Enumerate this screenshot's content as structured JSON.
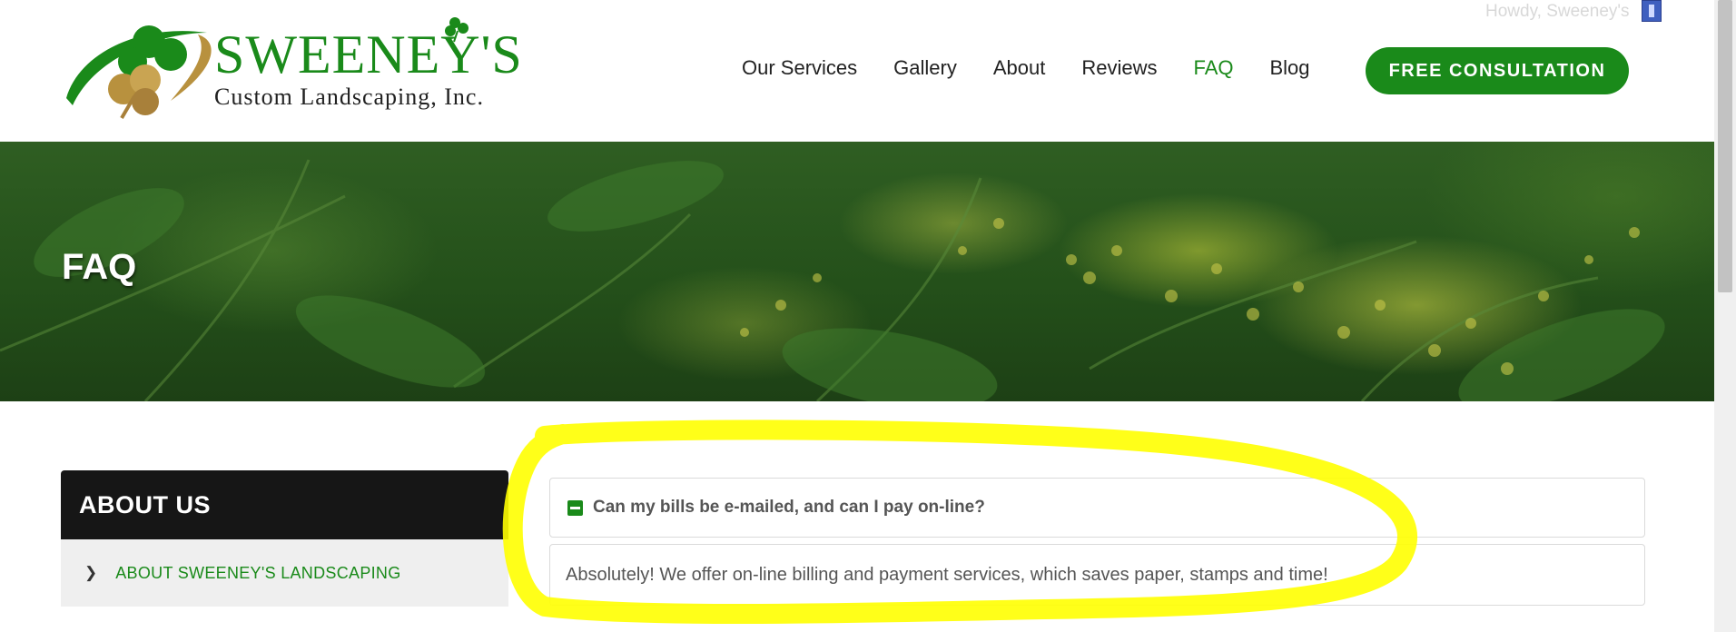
{
  "brand": {
    "name": "SWEENEY'S",
    "tagline": "Custom Landscaping, Inc."
  },
  "admin_bar": {
    "greeting": "Howdy, Sweeney's"
  },
  "nav": {
    "items": [
      {
        "label": "Our Services",
        "active": false
      },
      {
        "label": "Gallery",
        "active": false
      },
      {
        "label": "About",
        "active": false
      },
      {
        "label": "Reviews",
        "active": false
      },
      {
        "label": "FAQ",
        "active": true
      },
      {
        "label": "Blog",
        "active": false
      }
    ],
    "cta_label": "FREE CONSULTATION"
  },
  "hero": {
    "title": "FAQ"
  },
  "sidebar": {
    "heading": "ABOUT US",
    "items": [
      {
        "label": "ABOUT SWEENEY'S LANDSCAPING"
      }
    ]
  },
  "faq": {
    "question": "Can my bills be e-mailed, and can I pay on-line?",
    "answer": "Absolutely! We offer on-line billing and payment services, which saves paper, stamps and time!",
    "expanded": true
  },
  "colors": {
    "brand_green": "#1a8a1a",
    "highlight_yellow": "#ffff00",
    "sidebar_head_bg": "#161616"
  },
  "icons": {
    "logo": "shamrock-logo-icon",
    "faq_toggle": "minus-box-icon",
    "sidebar_chevron": "chevron-right-icon",
    "user_avatar": "avatar-icon"
  }
}
